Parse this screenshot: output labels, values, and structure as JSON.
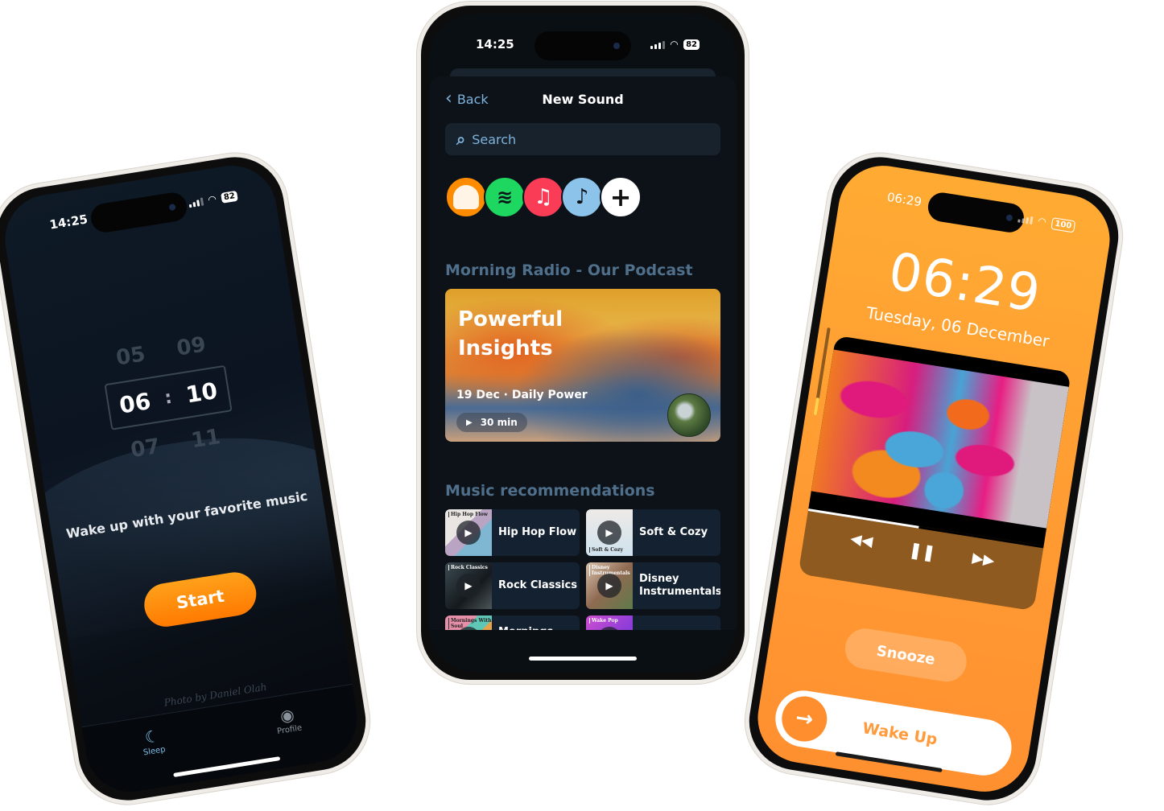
{
  "colors": {
    "accent_orange": "#ff8c1a",
    "dark_bg": "#0a0f14",
    "link_blue": "#7fb3dc",
    "section_heading": "#4f6f8a",
    "lock_orange": "#ffa033"
  },
  "left_phone": {
    "status": {
      "time": "14:25",
      "battery": "82"
    },
    "picker": {
      "above": {
        "hour": "05",
        "minute": "09"
      },
      "selected": {
        "hour": "06",
        "separator": ":",
        "minute": "10"
      },
      "below": {
        "hour": "07",
        "minute": "11"
      }
    },
    "tagline": "Wake up with your favorite music",
    "start_label": "Start",
    "photo_credit": "Photo by Daniel Olah",
    "tabs": [
      {
        "label": "Sleep",
        "icon": "moon-icon",
        "glyph": "☾",
        "active": true
      },
      {
        "label": "Profile",
        "icon": "profile-icon",
        "glyph": "◉",
        "active": false
      }
    ]
  },
  "middle_phone": {
    "status": {
      "time": "14:25",
      "battery": "82"
    },
    "back_label": "Back",
    "back_glyph": "‹",
    "title": "New Sound",
    "search_placeholder": "Search",
    "search_glyph": "⌕",
    "providers": [
      {
        "name": "audible-icon",
        "glyph": ""
      },
      {
        "name": "spotify-icon",
        "glyph": "≋"
      },
      {
        "name": "apple-music-icon",
        "glyph": "♫"
      },
      {
        "name": "music-note-icon",
        "glyph": "♪"
      },
      {
        "name": "add-provider-icon",
        "glyph": "+"
      }
    ],
    "podcast_section": "Morning Radio - Our Podcast",
    "podcast": {
      "title_line1": "Powerful",
      "title_line2": "Insights",
      "meta": "19 Dec · Daily Power",
      "play_glyph": "▶",
      "duration": "30 min"
    },
    "music_section": "Music recommendations",
    "playlists": [
      {
        "name": "Hip Hop Flow",
        "thumb_label": "Hip Hop Flow"
      },
      {
        "name": "Soft & Cozy",
        "thumb_label": "Soft & Cozy"
      },
      {
        "name": "Rock Classics",
        "thumb_label": "Rock Classics"
      },
      {
        "name": "Disney Instrumentals",
        "thumb_label": "Disney Instrumentals"
      },
      {
        "name": "Mornings With Soul",
        "thumb_label": "Mornings With Soul"
      },
      {
        "name": "Wake Pop",
        "thumb_label": "Wake Pop"
      }
    ],
    "play_glyph": "▶"
  },
  "right_phone": {
    "status": {
      "time": "06:29",
      "battery": "100"
    },
    "lock_time": "06:29",
    "lock_date": "Tuesday, 06 December",
    "media": {
      "progress": 0.47,
      "volume": 0.2,
      "rewind_glyph": "◀◀",
      "pause_glyph": "❚❚",
      "forward_glyph": "▶▶"
    },
    "snooze_label": "Snooze",
    "wake_label": "Wake Up",
    "wake_glyph": "→"
  }
}
